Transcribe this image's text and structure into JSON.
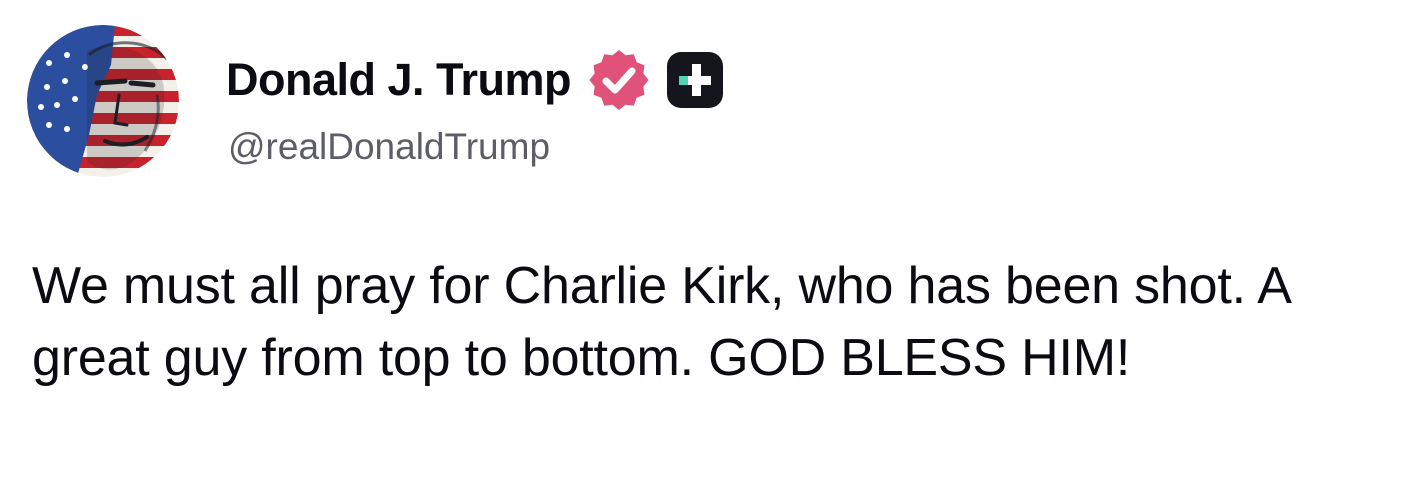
{
  "post": {
    "author": {
      "display_name": "Donald J. Trump",
      "handle": "@realDonaldTrump",
      "avatar_icon": "avatar-portrait-flag",
      "verified_icon": "verified-badge-icon",
      "verified_color": "#e0527a",
      "plus_icon": "plus-badge-icon",
      "plus_badge_bg": "#15151c",
      "plus_badge_accent": "#4fd6b0"
    },
    "text": "We must all pray for Charlie Kirk, who has been shot. A great guy from top to bottom. GOD BLESS HIM!"
  }
}
